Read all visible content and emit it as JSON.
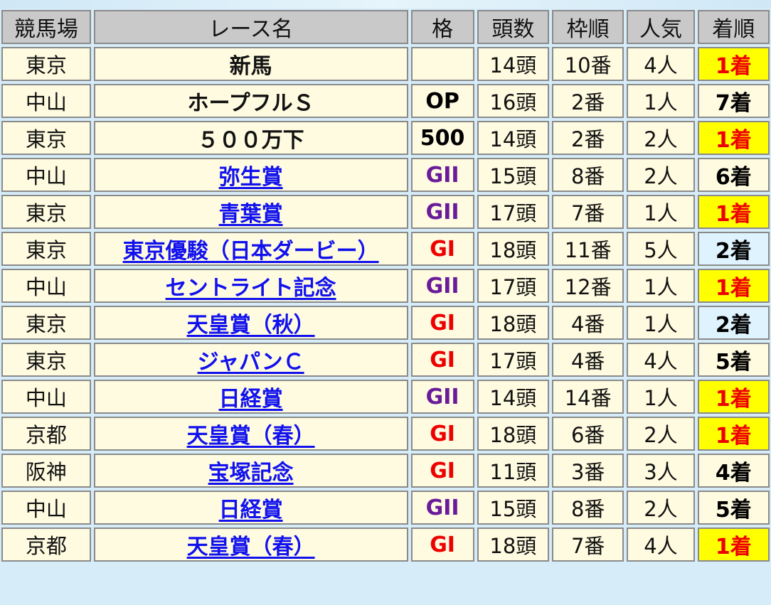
{
  "headers": {
    "venue": "競馬場",
    "race": "レース名",
    "grade": "格",
    "runners": "頭数",
    "gate": "枠順",
    "popularity": "人気",
    "finish": "着順"
  },
  "colors": {
    "page_background": "#d6ecf8",
    "header_background": "#c9c9c9",
    "cell_background": "#fffbe0",
    "link": "#1111ee",
    "grade_g1": "#ee0000",
    "grade_g2": "#6a1b9a",
    "grade_other": "#000000",
    "finish_win_bg": "#ffff00",
    "finish_win_text": "#ee0000",
    "finish_second_bg": "#dff3ff",
    "finish_other_text": "#000000"
  },
  "rows": [
    {
      "venue": "東京",
      "race": "新馬",
      "link": false,
      "grade": "",
      "grade_class": "other",
      "runners": "14頭",
      "gate": "10番",
      "popularity": "4人",
      "finish": "1着",
      "finish_class": "win"
    },
    {
      "venue": "中山",
      "race": "ホープフルＳ",
      "link": false,
      "grade": "OP",
      "grade_class": "other",
      "runners": "16頭",
      "gate": "2番",
      "popularity": "1人",
      "finish": "7着",
      "finish_class": "other"
    },
    {
      "venue": "東京",
      "race": "５００万下",
      "link": false,
      "grade": "500",
      "grade_class": "other",
      "runners": "14頭",
      "gate": "2番",
      "popularity": "2人",
      "finish": "1着",
      "finish_class": "win"
    },
    {
      "venue": "中山",
      "race": "弥生賞",
      "link": true,
      "grade": "GII",
      "grade_class": "g2",
      "runners": "15頭",
      "gate": "8番",
      "popularity": "2人",
      "finish": "6着",
      "finish_class": "other"
    },
    {
      "venue": "東京",
      "race": "青葉賞",
      "link": true,
      "grade": "GII",
      "grade_class": "g2",
      "runners": "17頭",
      "gate": "7番",
      "popularity": "1人",
      "finish": "1着",
      "finish_class": "win"
    },
    {
      "venue": "東京",
      "race": "東京優駿（日本ダービー）",
      "link": true,
      "grade": "GI",
      "grade_class": "g1",
      "runners": "18頭",
      "gate": "11番",
      "popularity": "5人",
      "finish": "2着",
      "finish_class": "second"
    },
    {
      "venue": "中山",
      "race": "セントライト記念",
      "link": true,
      "grade": "GII",
      "grade_class": "g2",
      "runners": "17頭",
      "gate": "12番",
      "popularity": "1人",
      "finish": "1着",
      "finish_class": "win"
    },
    {
      "venue": "東京",
      "race": "天皇賞（秋）",
      "link": true,
      "grade": "GI",
      "grade_class": "g1",
      "runners": "18頭",
      "gate": "4番",
      "popularity": "1人",
      "finish": "2着",
      "finish_class": "second"
    },
    {
      "venue": "東京",
      "race": "ジャパンＣ",
      "link": true,
      "grade": "GI",
      "grade_class": "g1",
      "runners": "17頭",
      "gate": "4番",
      "popularity": "4人",
      "finish": "5着",
      "finish_class": "other"
    },
    {
      "venue": "中山",
      "race": "日経賞",
      "link": true,
      "grade": "GII",
      "grade_class": "g2",
      "runners": "14頭",
      "gate": "14番",
      "popularity": "1人",
      "finish": "1着",
      "finish_class": "win"
    },
    {
      "venue": "京都",
      "race": "天皇賞（春）",
      "link": true,
      "grade": "GI",
      "grade_class": "g1",
      "runners": "18頭",
      "gate": "6番",
      "popularity": "2人",
      "finish": "1着",
      "finish_class": "win"
    },
    {
      "venue": "阪神",
      "race": "宝塚記念",
      "link": true,
      "grade": "GI",
      "grade_class": "g1",
      "runners": "11頭",
      "gate": "3番",
      "popularity": "3人",
      "finish": "4着",
      "finish_class": "other"
    },
    {
      "venue": "中山",
      "race": "日経賞",
      "link": true,
      "grade": "GII",
      "grade_class": "g2",
      "runners": "15頭",
      "gate": "8番",
      "popularity": "2人",
      "finish": "5着",
      "finish_class": "other"
    },
    {
      "venue": "京都",
      "race": "天皇賞（春）",
      "link": true,
      "grade": "GI",
      "grade_class": "g1",
      "runners": "18頭",
      "gate": "7番",
      "popularity": "4人",
      "finish": "1着",
      "finish_class": "win"
    }
  ]
}
